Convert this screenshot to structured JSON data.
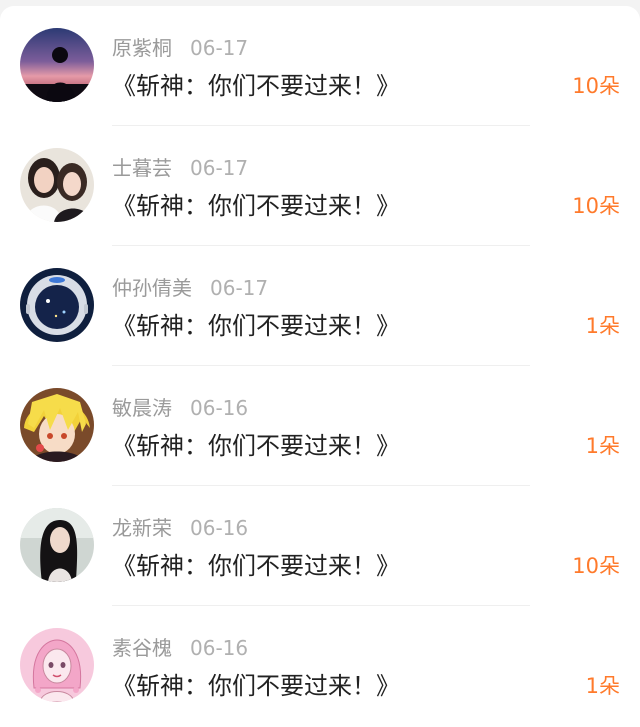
{
  "colors": {
    "accent": "#ff7a2b",
    "name_text": "#9a9a9a",
    "message_text": "#222222"
  },
  "comments": [
    {
      "name": "原紫桐",
      "date": "06-17",
      "message": "《斩神：你们不要过来！》",
      "gift": "10朵",
      "avatar_icon": "sunset-silhouette-avatar"
    },
    {
      "name": "士暮芸",
      "date": "06-17",
      "message": "《斩神：你们不要过来！》",
      "gift": "10朵",
      "avatar_icon": "two-girls-photo-avatar"
    },
    {
      "name": "仲孙倩美",
      "date": "06-17",
      "message": "《斩神：你们不要过来！》",
      "gift": "1朵",
      "avatar_icon": "astronaut-helmet-avatar"
    },
    {
      "name": "敏晨涛",
      "date": "06-16",
      "message": "《斩神：你们不要过来！》",
      "gift": "1朵",
      "avatar_icon": "anime-blonde-avatar"
    },
    {
      "name": "龙新荣",
      "date": "06-16",
      "message": "《斩神：你们不要过来！》",
      "gift": "10朵",
      "avatar_icon": "dark-hair-girl-avatar"
    },
    {
      "name": "素谷槐",
      "date": "06-16",
      "message": "《斩神：你们不要过来！》",
      "gift": "1朵",
      "avatar_icon": "pink-cartoon-girl-avatar"
    }
  ]
}
